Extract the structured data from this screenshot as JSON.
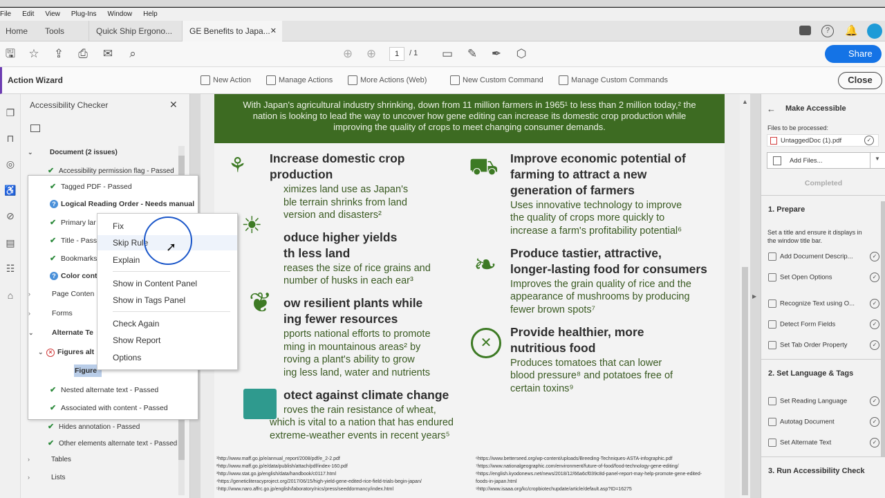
{
  "menu": [
    "File",
    "Edit",
    "View",
    "Plug-Ins",
    "Window",
    "Help"
  ],
  "tabs": {
    "home": "Home",
    "tools": "Tools",
    "doc1": "Quick Ship Ergono...",
    "doc2": "GE Benefits to Japa..."
  },
  "toolbar": {
    "page_current": "1",
    "page_total": "/ 1",
    "share": "Share"
  },
  "actionbar": {
    "title": "Action Wizard",
    "new_action": "New Action",
    "manage_actions": "Manage Actions",
    "more_actions": "More Actions (Web)",
    "new_command": "New Custom Command",
    "manage_commands": "Manage Custom Commands",
    "close": "Close"
  },
  "checker": {
    "title": "Accessibility Checker",
    "document_header": "Document (2 issues)",
    "perm_flag": "Accessibility permission flag - Passed",
    "tagged": "Tagged PDF - Passed",
    "reading_order": "Logical Reading Order - Needs manual",
    "primary_lang": "Primary lar",
    "title_row": "Title - Pass",
    "bookmarks": "Bookmarks",
    "color": "Color cont",
    "page_content": "Page Conten",
    "forms": "Forms",
    "alt_text": "Alternate Te",
    "figures_alt": "Figures alt",
    "figure": "Figure",
    "nested_alt": "Nested alternate text - Passed",
    "assoc": "Associated with content - Passed",
    "hides": "Hides annotation - Passed",
    "other_alt": "Other elements alternate text - Passed",
    "tables": "Tables",
    "lists": "Lists"
  },
  "context_menu": {
    "fix": "Fix",
    "skip": "Skip Rule",
    "explain": "Explain",
    "show_content": "Show in Content Panel",
    "show_tags": "Show in Tags Panel",
    "check_again": "Check Again",
    "show_report": "Show Report",
    "options": "Options"
  },
  "doc": {
    "banner": "With Japan's agricultural industry shrinking, down from 11 million farmers in 1965¹ to less than 2 million today,² the nation is looking to lead the way to uncover how gene editing can increase its domestic crop production while improving the quality of crops to meet changing consumer demands.",
    "h1a": "Increase domestic crop",
    "h1b": "production",
    "p1a": "ximizes land use as Japan's",
    "p1b": "ble terrain shrinks from land",
    "p1c": "version and disasters²",
    "h2a": "oduce higher yields",
    "h2b": "th less land",
    "p2a": "reases the size of rice grains and",
    "p2b": "number of husks in each ear³",
    "h3a": "ow resilient plants while",
    "h3b": "ing fewer resources",
    "p3a": "pports national efforts to promote",
    "p3b": "ming in mountainous areas² by",
    "p3c": "roving a plant's ability to grow",
    "p3d": "ing less land, water and nutrients",
    "h4": "otect against climate change",
    "p4a": "roves the rain resistance of wheat,",
    "p4b": "which is vital to a nation that has endured",
    "p4c": "extreme-weather events in recent years⁵",
    "r1a": "Improve economic potential of",
    "r1b": "farming to attract a new",
    "r1c": "generation of farmers",
    "rp1a": "Uses innovative technology to improve",
    "rp1b": "the quality of crops more quickly to",
    "rp1c": "increase a farm's profitability potential⁶",
    "r2a": "Produce tastier, attractive,",
    "r2b": "longer-lasting food for consumers",
    "rp2a": "Improves the grain quality of rice and the",
    "rp2b": "appearance of mushrooms by producing",
    "rp2c": "fewer brown spots⁷",
    "r3a": "Provide healthier, more",
    "r3b": "nutritious food",
    "rp3a": "Produces tomatoes that can lower",
    "rp3b": "blood pressure⁸ and potatoes free of",
    "rp3c": "certain toxins⁹",
    "fl1": "¹http://www.maff.go.jp/e/annual_report/2008/pdf/e_2-2.pdf",
    "fl2": "²http://www.maff.go.jp/e/data/publish/attach/pdf/index-160.pdf",
    "fl3": "³http://www.stat.go.jp/english/data/handbook/c0117.html",
    "fl4": "⁴https://geneticliteracyproject.org/2017/06/15/high-yield-gene-edited-rice-field-trials-begin-japan/",
    "fl5": "⁵http://www.naro.affrc.go.jp/english/laboratory/nics/press/seeddormancy/index.html",
    "fr1": "⁶https://www.betterseed.org/wp-content/uploads/Breeding-Techniques-ASTA-infographic.pdf",
    "fr2": "⁷https://www.nationalgeographic.com/environment/future-of-food/food-technology-gene-editing/",
    "fr3": "⁸https://english.kyodonews.net/news/2018/12/66a6cf039c8d-panel-report-may-help-promote-gene-edited-",
    "fr4": "foods-in-japan.html",
    "fr5": "⁹http://www.isaaa.org/kc/cropbiotechupdate/article/default.asp?ID=16275"
  },
  "right": {
    "title": "Make Accessible",
    "files_label": "Files to be processed:",
    "file": "UntaggedDoc (1).pdf",
    "add_files": "Add Files...",
    "completed": "Completed",
    "s1": "1. Prepare",
    "s1desc1": "Set a title and ensure it displays in",
    "s1desc2": "the window title bar.",
    "a1": "Add Document Descrip...",
    "a2": "Set Open Options",
    "a3": "Recognize Text using O...",
    "a4": "Detect Form Fields",
    "a5": "Set Tab Order Property",
    "s2": "2. Set Language & Tags",
    "b1": "Set Reading Language",
    "b2": "Autotag Document",
    "b3": "Set Alternate Text",
    "s3": "3. Run Accessibility Check"
  }
}
